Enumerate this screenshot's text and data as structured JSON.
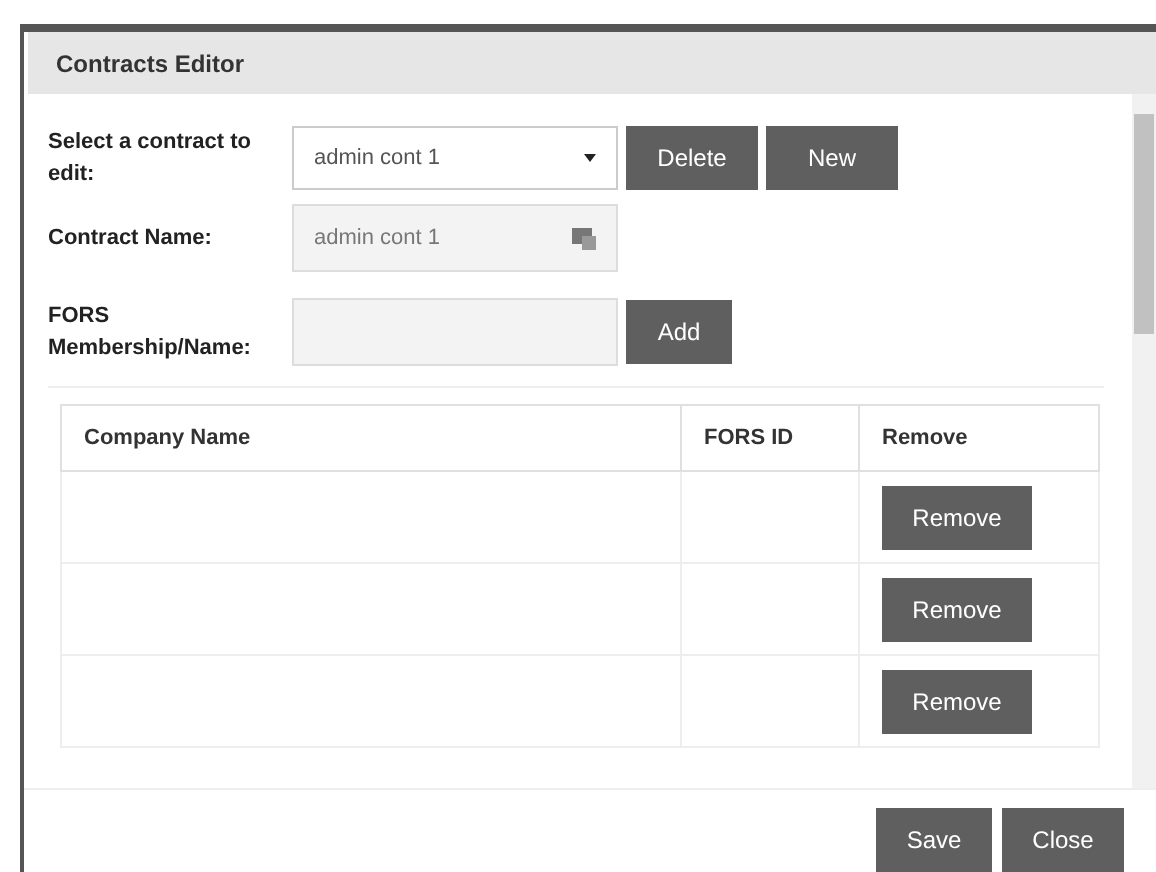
{
  "dialog": {
    "title": "Contracts Editor"
  },
  "select_contract": {
    "label": "Select a contract to edit:",
    "value": "admin cont 1",
    "buttons": [
      "Delete",
      "New"
    ]
  },
  "contract_name": {
    "label": "Contract Name:",
    "value": "admin cont 1"
  },
  "fors_membership": {
    "label": "FORS Membership/Name:",
    "button": "Add"
  },
  "table": {
    "columns": [
      "Company Name",
      "FORS ID",
      "Remove"
    ],
    "rows": [
      {
        "button": "Remove"
      },
      {
        "button": "Remove"
      },
      {
        "button": "Remove"
      }
    ]
  },
  "footer_buttons": [
    "Save",
    "Close"
  ]
}
